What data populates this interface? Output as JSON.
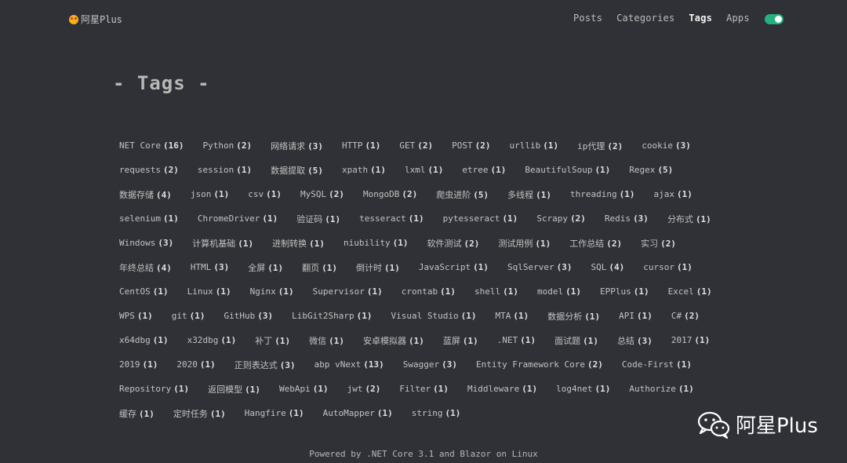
{
  "header": {
    "brand": "阿星Plus",
    "nav": [
      "Posts",
      "Categories",
      "Tags",
      "Apps"
    ],
    "active": "Tags",
    "toggle_on": true,
    "toggle_color": "#25b07d"
  },
  "page_title": "- Tags -",
  "tags": [
    [
      [
        "NET Core",
        "(16)"
      ],
      [
        "Python",
        "(2)"
      ],
      [
        "网络请求",
        "(3)"
      ],
      [
        "HTTP",
        "(1)"
      ],
      [
        "GET",
        "(2)"
      ],
      [
        "POST",
        "(2)"
      ],
      [
        "urllib",
        "(1)"
      ],
      [
        "ip代理",
        "(2)"
      ],
      [
        "cookie",
        "(3)"
      ]
    ],
    [
      [
        "requests",
        "(2)"
      ],
      [
        "session",
        "(1)"
      ],
      [
        "数据提取",
        "(5)"
      ],
      [
        "xpath",
        "(1)"
      ],
      [
        "lxml",
        "(1)"
      ],
      [
        "etree",
        "(1)"
      ],
      [
        "BeautifulSoup",
        "(1)"
      ],
      [
        "Regex",
        "(5)"
      ]
    ],
    [
      [
        "数据存储",
        "(4)"
      ],
      [
        "json",
        "(1)"
      ],
      [
        "csv",
        "(1)"
      ],
      [
        "MySQL",
        "(2)"
      ],
      [
        "MongoDB",
        "(2)"
      ],
      [
        "爬虫进阶",
        "(5)"
      ],
      [
        "多线程",
        "(1)"
      ],
      [
        "threading",
        "(1)"
      ],
      [
        "ajax",
        "(1)"
      ]
    ],
    [
      [
        "selenium",
        "(1)"
      ],
      [
        "ChromeDriver",
        "(1)"
      ],
      [
        "验证码",
        "(1)"
      ],
      [
        "tesseract",
        "(1)"
      ],
      [
        "pytesseract",
        "(1)"
      ],
      [
        "Scrapy",
        "(2)"
      ],
      [
        "Redis",
        "(3)"
      ],
      [
        "分布式",
        "(1)"
      ]
    ],
    [
      [
        "Windows",
        "(3)"
      ],
      [
        "计算机基础",
        "(1)"
      ],
      [
        "进制转换",
        "(1)"
      ],
      [
        "niubility",
        "(1)"
      ],
      [
        "软件测试",
        "(2)"
      ],
      [
        "测试用例",
        "(1)"
      ],
      [
        "工作总结",
        "(2)"
      ],
      [
        "实习",
        "(2)"
      ]
    ],
    [
      [
        "年终总结",
        "(4)"
      ],
      [
        "HTML",
        "(3)"
      ],
      [
        "全屏",
        "(1)"
      ],
      [
        "翻页",
        "(1)"
      ],
      [
        "倒计时",
        "(1)"
      ],
      [
        "JavaScript",
        "(1)"
      ],
      [
        "SqlServer",
        "(3)"
      ],
      [
        "SQL",
        "(4)"
      ],
      [
        "cursor",
        "(1)"
      ]
    ],
    [
      [
        "CentOS",
        "(1)"
      ],
      [
        "Linux",
        "(1)"
      ],
      [
        "Nginx",
        "(1)"
      ],
      [
        "Supervisor",
        "(1)"
      ],
      [
        "crontab",
        "(1)"
      ],
      [
        "shell",
        "(1)"
      ],
      [
        "model",
        "(1)"
      ],
      [
        "EPPlus",
        "(1)"
      ],
      [
        "Excel",
        "(1)"
      ]
    ],
    [
      [
        "WPS",
        "(1)"
      ],
      [
        "git",
        "(1)"
      ],
      [
        "GitHub",
        "(3)"
      ],
      [
        "LibGit2Sharp",
        "(1)"
      ],
      [
        "Visual Studio",
        "(1)"
      ],
      [
        "MTA",
        "(1)"
      ],
      [
        "数据分析",
        "(1)"
      ],
      [
        "API",
        "(1)"
      ],
      [
        "C#",
        "(2)"
      ]
    ],
    [
      [
        "x64dbg",
        "(1)"
      ],
      [
        "x32dbg",
        "(1)"
      ],
      [
        "补丁",
        "(1)"
      ],
      [
        "微信",
        "(1)"
      ],
      [
        "安卓模拟器",
        "(1)"
      ],
      [
        "蓝屏",
        "(1)"
      ],
      [
        ".NET",
        "(1)"
      ],
      [
        "面试题",
        "(1)"
      ],
      [
        "总结",
        "(3)"
      ],
      [
        "2017",
        "(1)"
      ]
    ],
    [
      [
        "2019",
        "(1)"
      ],
      [
        "2020",
        "(1)"
      ],
      [
        "正则表达式",
        "(3)"
      ],
      [
        "abp vNext",
        "(13)"
      ],
      [
        "Swagger",
        "(3)"
      ],
      [
        "Entity Framework Core",
        "(2)"
      ],
      [
        "Code-First",
        "(1)"
      ]
    ],
    [
      [
        "Repository",
        "(1)"
      ],
      [
        "返回模型",
        "(1)"
      ],
      [
        "WebApi",
        "(1)"
      ],
      [
        "jwt",
        "(2)"
      ],
      [
        "Filter",
        "(1)"
      ],
      [
        "Middleware",
        "(1)"
      ],
      [
        "log4net",
        "(1)"
      ],
      [
        "Authorize",
        "(1)"
      ]
    ],
    [
      [
        "缓存",
        "(1)"
      ],
      [
        "定时任务",
        "(1)"
      ],
      [
        "Hangfire",
        "(1)"
      ],
      [
        "AutoMapper",
        "(1)"
      ],
      [
        "string",
        "(1)"
      ]
    ]
  ],
  "footer": "Powered by .NET Core 3.1 and Blazor on Linux",
  "watermark": "阿星Plus",
  "chart_data": {
    "type": "table",
    "title": "- Tags -",
    "categories": [],
    "values": []
  }
}
